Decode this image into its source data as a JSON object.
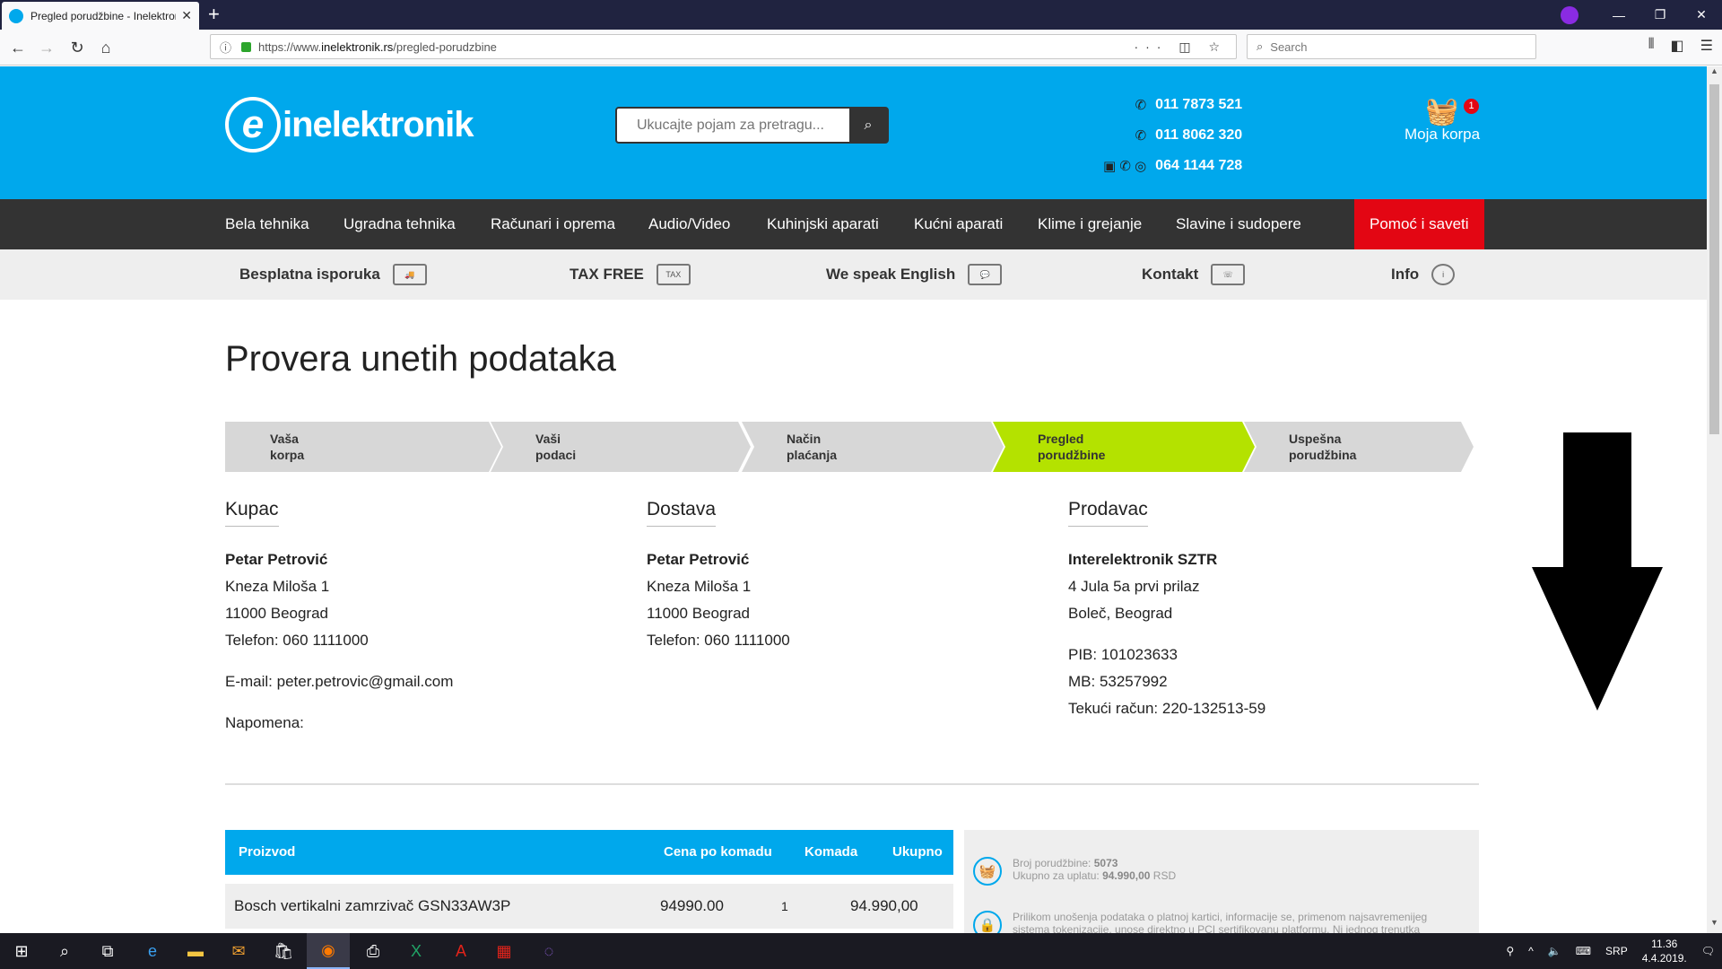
{
  "browser": {
    "tab_title": "Pregled porudžbine - Inelektronik",
    "url_prefix": "https://www.",
    "url_domain": "inelektronik.rs",
    "url_path": "/pregled-porudzbine",
    "search_placeholder": "Search"
  },
  "header": {
    "logo_text": "inelektronik",
    "search_placeholder": "Ukucajte pojam za pretragu...",
    "phones": [
      "011 7873 521",
      "011 8062 320",
      "064 1144 728"
    ],
    "cart_label": "Moja korpa",
    "cart_count": "1"
  },
  "nav": {
    "items": [
      "Bela tehnika",
      "Ugradna tehnika",
      "Računari i oprema",
      "Audio/Video",
      "Kuhinjski aparati",
      "Kućni aparati",
      "Klime i grejanje",
      "Slavine i sudopere"
    ],
    "help": "Pomoć i saveti"
  },
  "infobar": {
    "items": [
      "Besplatna isporuka",
      "TAX FREE",
      "We speak English",
      "Kontakt",
      "Info"
    ]
  },
  "page": {
    "title": "Provera unetih podataka"
  },
  "steps": [
    {
      "line1": "Vaša",
      "line2": "korpa"
    },
    {
      "line1": "Vaši",
      "line2": "podaci"
    },
    {
      "line1": "Način",
      "line2": "plaćanja"
    },
    {
      "line1": "Pregled",
      "line2": "porudžbine"
    },
    {
      "line1": "Uspešna",
      "line2": "porudžbina"
    }
  ],
  "customer": {
    "heading": "Kupac",
    "name": "Petar Petrović",
    "street": "Kneza Miloša 1",
    "city": "11000 Beograd",
    "phone": "Telefon: 060 1111000",
    "email": "E-mail: peter.petrovic@gmail.com",
    "note": "Napomena:"
  },
  "delivery": {
    "heading": "Dostava",
    "name": "Petar Petrović",
    "street": "Kneza Miloša 1",
    "city": "11000 Beograd",
    "phone": "Telefon: 060 1111000"
  },
  "seller": {
    "heading": "Prodavac",
    "name": "Interelektronik SZTR",
    "street": "4 Jula 5a prvi prilaz",
    "city": "Boleč, Beograd",
    "pib": "PIB: 101023633",
    "mb": "MB: 53257992",
    "account": "Tekući račun: 220-132513-59"
  },
  "order_table": {
    "headers": [
      "Proizvod",
      "Cena po komadu",
      "Komada",
      "Ukupno"
    ],
    "rows": [
      {
        "product": "Bosch vertikalni zamrzivač GSN33AW3P",
        "price": "94990.00",
        "qty": "1",
        "total": "94.990,00 RSD"
      }
    ]
  },
  "summary": {
    "order_label": "Broj porudžbine: ",
    "order_number": "5073",
    "total_label": "Ukupno za uplatu: ",
    "total_value": "94.990,00",
    "total_currency": " RSD",
    "security_line1": "Prilikom unošenja podataka o platnoj kartici, informacije se, primenom najsavremenijeg",
    "security_line2": "sistema tokenizacije, unose direktno u PCI sertifikovanu platformu. Ni jednog trenutka"
  },
  "taskbar": {
    "lang": "SRP",
    "time": "11.36",
    "date": "4.4.2019."
  },
  "colors": {
    "brand_blue": "#00a8ec",
    "nav_dark": "#333333",
    "help_red": "#e30613",
    "active_step": "#b4e200"
  }
}
